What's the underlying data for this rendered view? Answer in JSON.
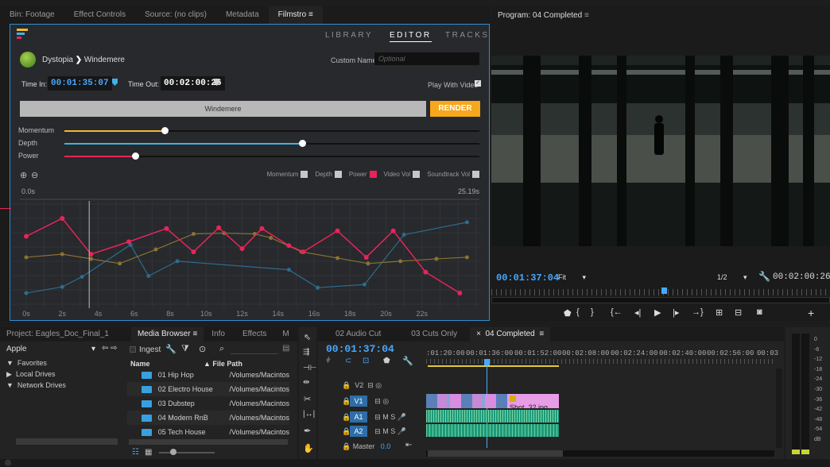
{
  "filmstro_panel": {
    "tabs": [
      "Bin: Footage",
      "Effect Controls",
      "Source: (no clips)",
      "Metadata",
      "Filmstro"
    ],
    "active_tab_menu": "≡",
    "nav": [
      "LIBRARY",
      "EDITOR",
      "TRACKS"
    ],
    "breadcrumb": {
      "album": "Dystopia",
      "arrow": "❯",
      "track": "Windemere"
    },
    "custom_name_label": "Custom Name:",
    "custom_name_placeholder": "Optional",
    "time_in_label": "Time In:",
    "time_in": "00:01:35:07",
    "time_out_label": "Time Out:",
    "time_out": "00:02:00:26",
    "play_with_video": "Play With Video",
    "track_bar": "Windemere",
    "render": "RENDER",
    "sliders": [
      {
        "label": "Momentum",
        "value": 0.24,
        "color": "#f4b731"
      },
      {
        "label": "Depth",
        "value": 0.57,
        "color": "#3fb3e6"
      },
      {
        "label": "Power",
        "value": 0.17,
        "color": "#e8245a"
      }
    ],
    "legend": [
      "Momentum",
      "Depth",
      "Power",
      "Video Vol",
      "Soundtrack Vol"
    ],
    "timeline_start": "0.0s",
    "timeline_end": "25.19s"
  },
  "chart_data": {
    "type": "line",
    "x_ticks": [
      "0s",
      "2s",
      "4s",
      "6s",
      "8s",
      "10s",
      "12s",
      "14s",
      "16s",
      "18s",
      "20s",
      "22s"
    ],
    "xlim": [
      0,
      25.19
    ],
    "ylim": [
      0,
      1
    ],
    "playhead": 3.5,
    "series": [
      {
        "name": "Power",
        "color": "#e8245a",
        "x": [
          0,
          2,
          3.6,
          5.7,
          7.8,
          9.3,
          10.7,
          12,
          13.1,
          14.6,
          15.4,
          17.3,
          18.9,
          20.4,
          22.2,
          24.1
        ],
        "y": [
          0.75,
          0.98,
          0.52,
          0.68,
          0.85,
          0.55,
          0.86,
          0.59,
          0.85,
          0.63,
          0.55,
          0.82,
          0.48,
          0.82,
          0.29,
          0.02
        ]
      },
      {
        "name": "Momentum",
        "color": "#8a7230",
        "x": [
          0,
          2,
          3.6,
          5.2,
          7.2,
          9.3,
          11,
          12.7,
          13.6,
          15.3,
          17.3,
          19,
          20.8,
          22.8,
          24.5
        ],
        "y": [
          0.48,
          0.52,
          0.46,
          0.4,
          0.58,
          0.78,
          0.79,
          0.78,
          0.73,
          0.55,
          0.47,
          0.4,
          0.43,
          0.46,
          0.48
        ]
      },
      {
        "name": "Depth",
        "color": "#2e6b8c",
        "x": [
          0,
          2,
          3.1,
          5.8,
          6.8,
          8.4,
          14.6,
          16.2,
          18.8,
          21,
          24.5
        ],
        "y": [
          0.02,
          0.1,
          0.23,
          0.64,
          0.24,
          0.43,
          0.32,
          0.09,
          0.13,
          0.77,
          0.93
        ]
      }
    ]
  },
  "program_monitor": {
    "title": "Program: 04 Completed",
    "menu": "≡",
    "timecode": "00:01:37:04",
    "fit": "Fit",
    "fraction": "1/2",
    "duration": "00:02:00:26"
  },
  "project_panel": {
    "tabs": [
      "Project: Eagles_Doc_Final_1",
      "Media Browser",
      "Info",
      "Effects",
      "M"
    ],
    "more": "»",
    "location": "Apple",
    "ingest": "Ingest",
    "tree": [
      "Favorites",
      "Local Drives",
      "Network Drives"
    ],
    "columns": [
      "Name",
      "File Path"
    ],
    "files": [
      {
        "name": "01 Hip Hop",
        "path": "/Volumes/Macintos"
      },
      {
        "name": "02 Electro House",
        "path": "/Volumes/Macintos"
      },
      {
        "name": "03 Dubstep",
        "path": "/Volumes/Macintos"
      },
      {
        "name": "04 Modern RnB",
        "path": "/Volumes/Macintos"
      },
      {
        "name": "05 Tech House",
        "path": "/Volumes/Macintos"
      }
    ]
  },
  "timeline_panel": {
    "tabs": [
      "02 Audio Cut",
      "03 Cuts Only",
      "04 Completed"
    ],
    "close": "×",
    "menu": "≡",
    "timecode": "00:01:37:04",
    "ruler": [
      ":01:20:00",
      "00:01:36:00",
      "00:01:52:00",
      "00:02:08:00",
      "00:02:24:00",
      "00:02:40:00",
      "00:02:56:00",
      "00:03"
    ],
    "tracks": {
      "v2": "V2",
      "v1": "V1",
      "a1": "A1",
      "a2": "A2",
      "master": "Master",
      "master_val": "0.0",
      "m": "M",
      "s": "S"
    },
    "clip_label": "Shot_32.jpg"
  },
  "meter": {
    "scale": [
      "0",
      "-6",
      "-12",
      "-18",
      "-24",
      "-30",
      "-36",
      "-42",
      "-48",
      "-54",
      "dB"
    ]
  }
}
